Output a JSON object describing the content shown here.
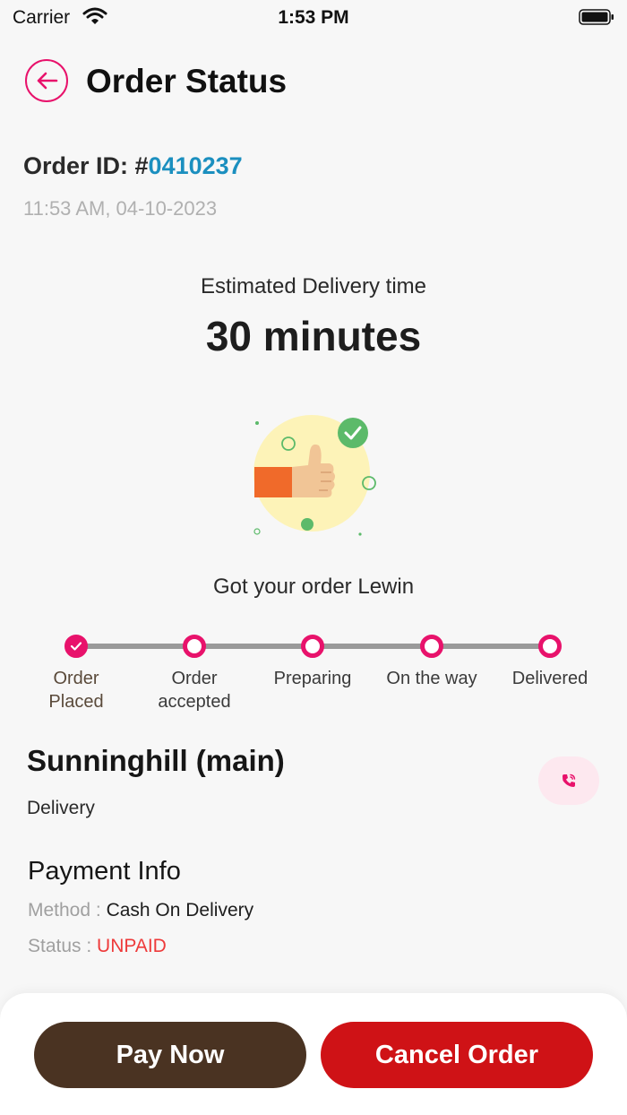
{
  "status_bar": {
    "carrier": "Carrier",
    "time": "1:53 PM"
  },
  "header": {
    "title": "Order Status"
  },
  "order": {
    "id_label": "Order ID: #",
    "id_number": "0410237",
    "datetime": "11:53 AM, 04-10-2023"
  },
  "estimate": {
    "label": "Estimated Delivery time",
    "value": "30 minutes"
  },
  "message": "Got your order Lewin",
  "steps": [
    {
      "label_line1": "Order",
      "label_line2": "Placed",
      "done": true
    },
    {
      "label_line1": "Order",
      "label_line2": "accepted",
      "done": false
    },
    {
      "label_line1": "Preparing",
      "label_line2": "",
      "done": false
    },
    {
      "label_line1": "On the way",
      "label_line2": "",
      "done": false
    },
    {
      "label_line1": "Delivered",
      "label_line2": "",
      "done": false
    }
  ],
  "store": {
    "name": "Sunninghill (main)",
    "type": "Delivery"
  },
  "payment": {
    "title": "Payment Info",
    "method_key": "Method : ",
    "method_value": "Cash On Delivery",
    "status_key": "Status : ",
    "status_value": "UNPAID"
  },
  "actions": {
    "pay_now": "Pay Now",
    "cancel_order": "Cancel Order"
  },
  "colors": {
    "accent": "#e8126b",
    "link": "#1b8fbf",
    "pay_button": "#4a3322",
    "cancel_button": "#cf1216",
    "unpaid": "#ee3a3a"
  },
  "icons": [
    "wifi-icon",
    "battery-icon",
    "back-arrow-icon",
    "checkmark-icon",
    "thumbs-up-icon",
    "phone-icon"
  ]
}
